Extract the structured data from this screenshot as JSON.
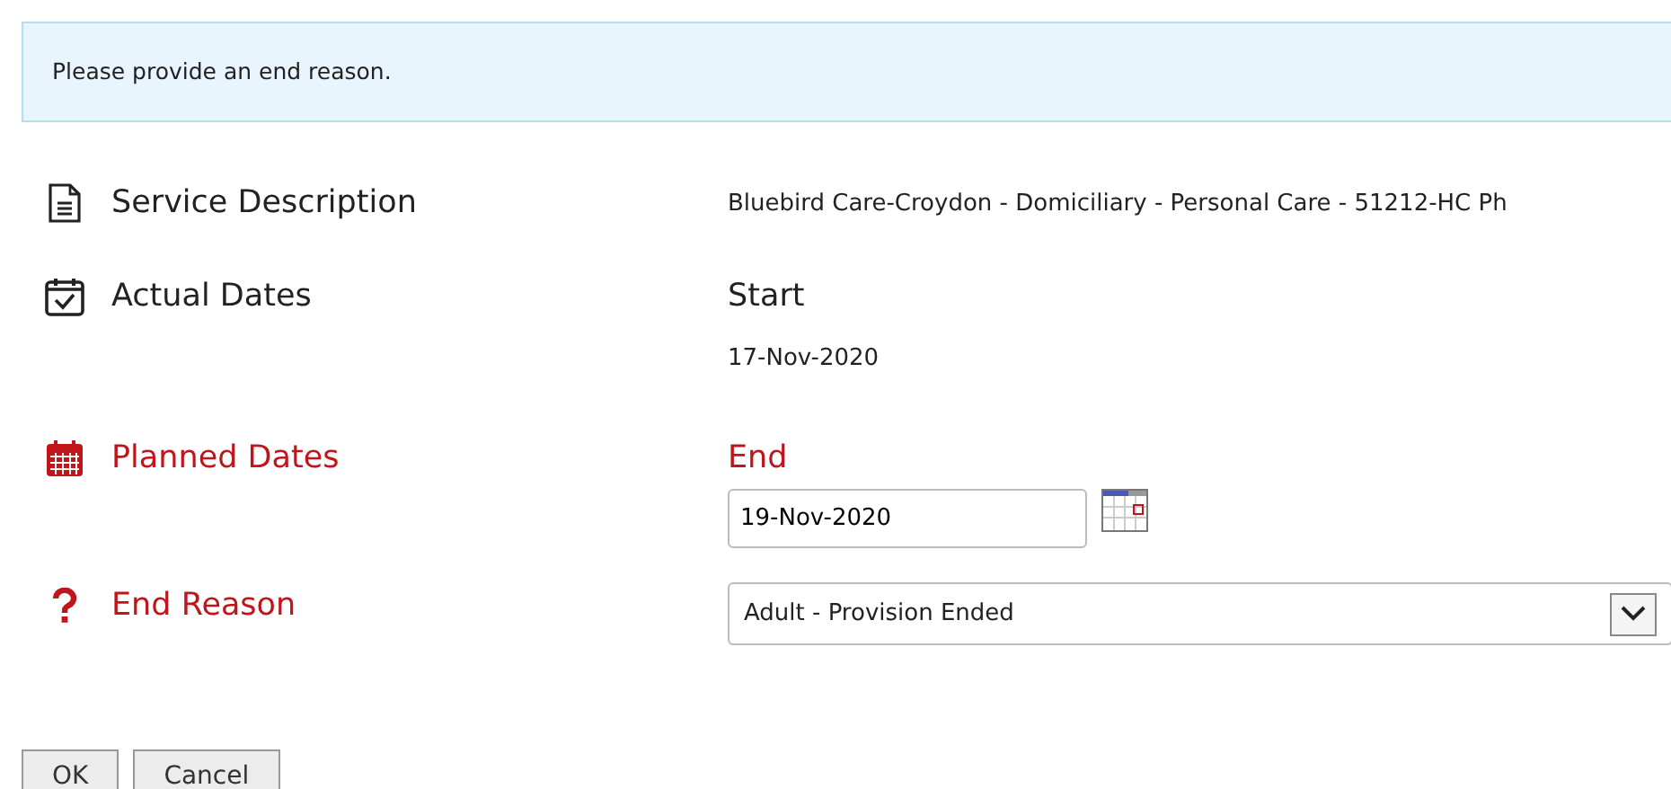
{
  "alert": {
    "text": "Please provide an end reason."
  },
  "fields": [
    {
      "kind": "text",
      "label": "Service Description",
      "required": false,
      "value": "Bluebird Care-Croydon - Domiciliary - Personal Care - 51212-HC Ph"
    },
    {
      "kind": "dates",
      "label": "Actual Dates",
      "required": false,
      "heading": "Start",
      "value": "17-Nov-2020"
    },
    {
      "kind": "date-input",
      "label": "Planned Dates",
      "required": true,
      "heading": "End",
      "value": "19-Nov-2020"
    },
    {
      "kind": "select",
      "label": "End Reason",
      "required": true,
      "value": "Adult - Provision Ended"
    }
  ],
  "buttons": [
    "OK",
    "Cancel"
  ]
}
